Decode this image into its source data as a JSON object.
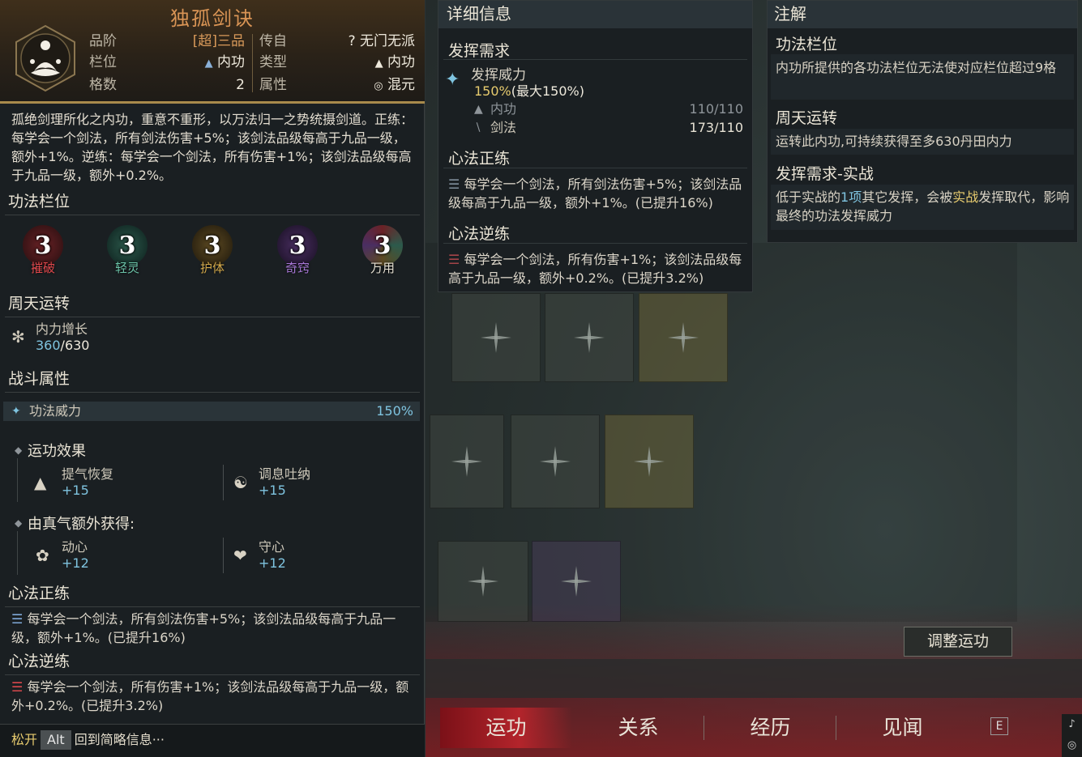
{
  "skill": {
    "title": "独孤剑诀",
    "grade_label": "品阶",
    "grade_value": "[超]三品",
    "slot_label": "栏位",
    "slot_value": "内功",
    "cells_label": "格数",
    "cells_value": "2",
    "origin_label": "传自",
    "origin_value": "无门无派",
    "type_label": "类型",
    "type_value": "内功",
    "attr_label": "属性",
    "attr_value": "混元",
    "description": "孤绝剑理所化之内功，重意不重形，以万法归一之势统摄剑道。正练：每学会一个剑法，所有剑法伤害+5%；该剑法品级每高于九品一级，额外+1%。逆练：每学会一个剑法，所有伤害+1%；该剑法品级每高于九品一级，额外+0.2%。"
  },
  "left": {
    "section_slots": "功法栏位",
    "slots": [
      {
        "num": "3",
        "name": "摧破",
        "color": "#e0484c"
      },
      {
        "num": "3",
        "name": "轻灵",
        "color": "#6bc3a8"
      },
      {
        "num": "3",
        "name": "护体",
        "color": "#d2a84a"
      },
      {
        "num": "3",
        "name": "奇窍",
        "color": "#a978d8"
      },
      {
        "num": "3",
        "name": "万用",
        "color": "#e6e0d2"
      }
    ],
    "section_cycle": "周天运转",
    "cycle_name": "内力增长",
    "cycle_value_cur": "360",
    "cycle_value_max": "/630",
    "section_combat": "战斗属性",
    "power_label": "功法威力",
    "power_value": "150%",
    "effect_title": "运功效果",
    "effect1_name": "提气恢复",
    "effect1_val": "+15",
    "effect2_name": "调息吐纳",
    "effect2_val": "+15",
    "extra_title": "由真气额外获得:",
    "extra1_name": "动心",
    "extra1_val": "+12",
    "extra2_name": "守心",
    "extra2_val": "+12",
    "section_forward": "心法正练",
    "forward_text": "每学会一个剑法，所有剑法伤害+5%；该剑法品级每高于九品一级，额外+1%。(已提升16%)",
    "section_reverse": "心法逆练",
    "reverse_text": "每学会一个剑法，所有伤害+1%；该剑法品级每高于九品一级，额外+0.2%。(已提升3.2%)",
    "footer_release": "松开",
    "footer_key": "Alt",
    "footer_text": "回到简略信息···"
  },
  "detail": {
    "header": "详细信息",
    "req_title": "发挥需求",
    "req_power_label": "发挥威力",
    "req_power_value": "150%",
    "req_power_max": "(最大150%)",
    "req_neigong_label": "内功",
    "req_neigong_value": "110/110",
    "req_sword_label": "剑法",
    "req_sword_value": "173/110",
    "forward_title": "心法正练",
    "forward_text": "每学会一个剑法，所有剑法伤害+5%；该剑法品级每高于九品一级，额外+1%。(已提升16%)",
    "reverse_title": "心法逆练",
    "reverse_text": "每学会一个剑法，所有伤害+1%；该剑法品级每高于九品一级，额外+0.2%。(已提升3.2%)"
  },
  "notes": {
    "header": "注解",
    "n1_title": "功法栏位",
    "n1_text": "内功所提供的各功法栏位无法使对应栏位超过9格",
    "n2_title": "周天运转",
    "n2_text": "运转此内功,可持续获得至多630丹田内力",
    "n3_title": "发挥需求-实战",
    "n3_pre": "低于实战的",
    "n3_num": "1项",
    "n3_mid": "其它发挥，会被",
    "n3_hl": "实战",
    "n3_post": "发挥取代，影响最终的功法发挥威力"
  },
  "main": {
    "adjust_button": "调整运功",
    "tabs": [
      "运功",
      "关系",
      "经历",
      "见闻"
    ],
    "key_hint": "E"
  }
}
